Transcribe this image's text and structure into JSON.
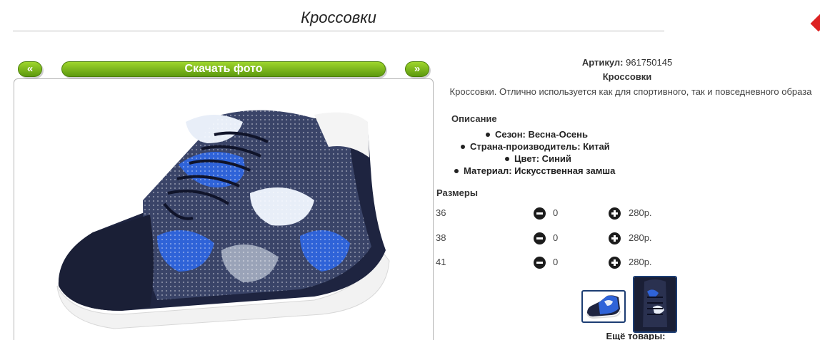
{
  "page": {
    "title": "Кроссовки"
  },
  "nav": {
    "prev_label": "«",
    "download_label": "Скачать фото",
    "next_label": "»"
  },
  "product": {
    "sku_label": "Артикул:",
    "sku_value": "961750145",
    "name": "Кроссовки",
    "description": "Кроссовки. Отлично используется как для спортивного, так и повседневного образа",
    "description_heading": "Описание",
    "attributes": [
      "Сезон: Весна-Осень",
      "Страна-производитель: Китай",
      "Цвет: Синий",
      "Материал: Искусственная замша"
    ]
  },
  "sizes": {
    "heading": "Размеры",
    "rows": [
      {
        "size": "36",
        "qty": "0",
        "price": "280р."
      },
      {
        "size": "38",
        "qty": "0",
        "price": "280р."
      },
      {
        "size": "41",
        "qty": "0",
        "price": "280р."
      }
    ]
  },
  "more_products_label": "Ещё товары:",
  "colors": {
    "button_green_top": "#9ed52c",
    "button_green_bottom": "#5d9a0f",
    "thumb_border": "#1c3d73",
    "shoe_navy": "#1e2440",
    "camo_blue": "#2f63d8"
  },
  "icons": [
    "minus-circle-icon",
    "plus-circle-icon"
  ]
}
